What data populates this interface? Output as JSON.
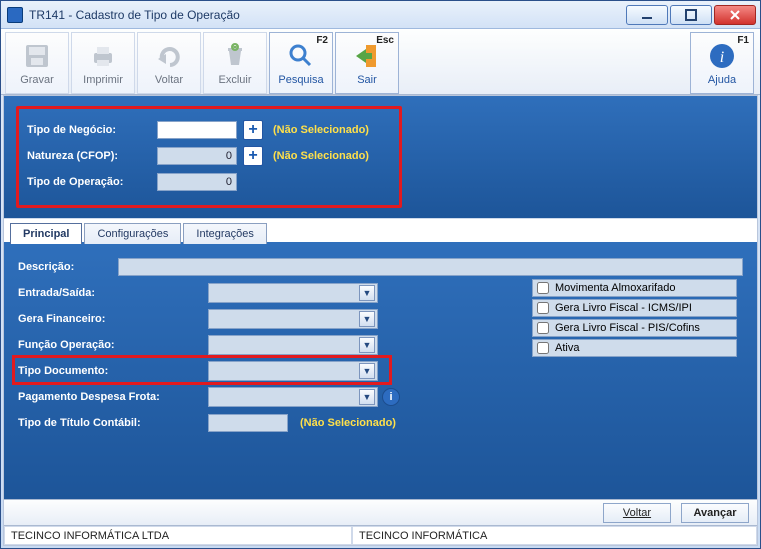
{
  "window": {
    "title": "TR141 - Cadastro de Tipo de Operação"
  },
  "toolbar": {
    "gravar": "Gravar",
    "imprimir": "Imprimir",
    "voltar": "Voltar",
    "excluir": "Excluir",
    "pesquisa": "Pesquisa",
    "pesquisa_kb": "F2",
    "sair": "Sair",
    "sair_kb": "Esc",
    "ajuda": "Ajuda",
    "ajuda_kb": "F1"
  },
  "topform": {
    "tipo_negocio_label": "Tipo de Negócio:",
    "tipo_negocio_value": "",
    "tipo_negocio_not_selected": "(Não Selecionado)",
    "natureza_label": "Natureza (CFOP):",
    "natureza_value": "0",
    "natureza_not_selected": "(Não Selecionado)",
    "tipo_operacao_label": "Tipo de Operação:",
    "tipo_operacao_value": "0"
  },
  "tabs": {
    "principal": "Principal",
    "configuracoes": "Configurações",
    "integracoes": "Integrações"
  },
  "principal": {
    "descricao_label": "Descrição:",
    "entrada_saida_label": "Entrada/Saída:",
    "gera_financeiro_label": "Gera Financeiro:",
    "funcao_operacao_label": "Função Operação:",
    "tipo_documento_label": "Tipo Documento:",
    "pagamento_frota_label": "Pagamento Despesa Frota:",
    "tipo_titulo_label": "Tipo de Título Contábil:",
    "tipo_titulo_not_selected": "(Não Selecionado)",
    "checks": {
      "mov_almox": "Movimenta Almoxarifado",
      "livro_icms": "Gera Livro Fiscal - ICMS/IPI",
      "livro_pis": "Gera Livro Fiscal - PIS/Cofins",
      "ativa": "Ativa"
    }
  },
  "nav": {
    "voltar": "Voltar",
    "avancar": "Avançar"
  },
  "status": {
    "company": "TECINCO INFORMÁTICA LTDA",
    "user": "TECINCO INFORMÁTICA"
  }
}
